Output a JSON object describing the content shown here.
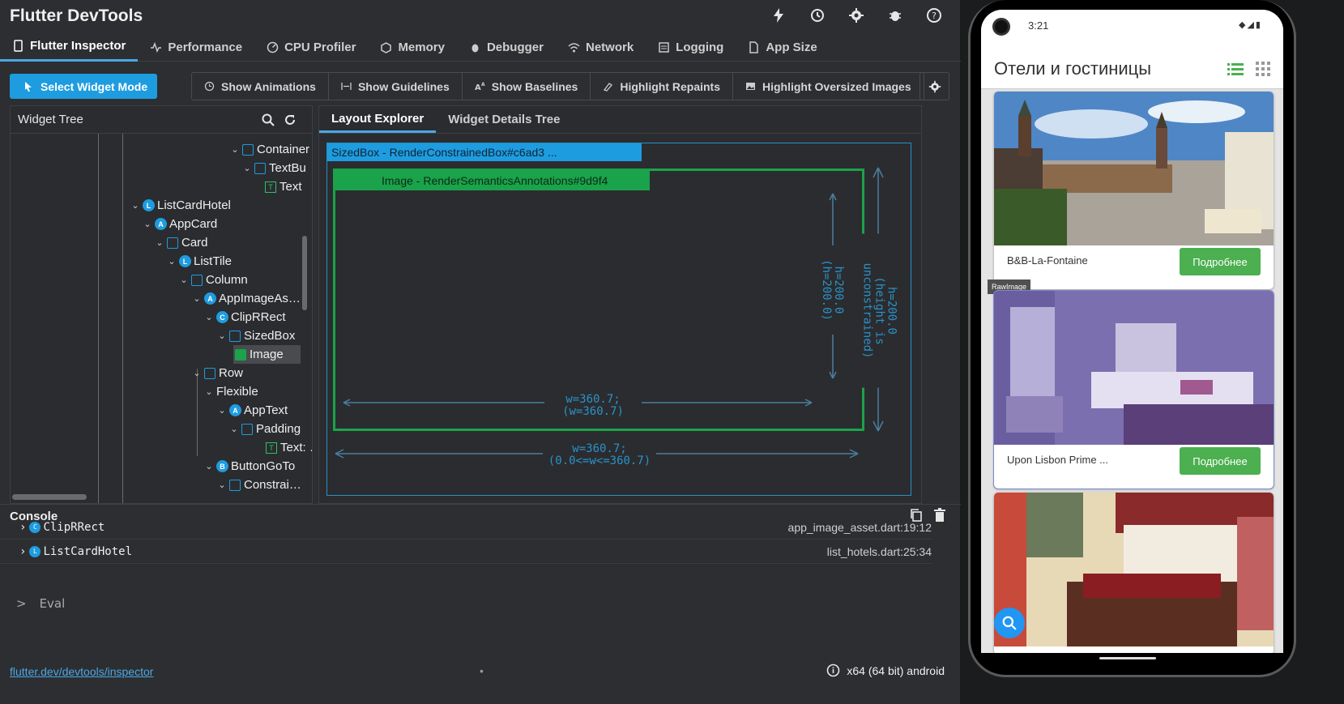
{
  "app": {
    "title": "Flutter DevTools"
  },
  "tabs": [
    {
      "label": "Flutter Inspector",
      "icon": "phone-icon",
      "active": true
    },
    {
      "label": "Performance",
      "icon": "pulse-icon"
    },
    {
      "label": "CPU Profiler",
      "icon": "gauge-icon"
    },
    {
      "label": "Memory",
      "icon": "memory-icon"
    },
    {
      "label": "Debugger",
      "icon": "bug-icon"
    },
    {
      "label": "Network",
      "icon": "wifi-icon"
    },
    {
      "label": "Logging",
      "icon": "logging-icon"
    },
    {
      "label": "App Size",
      "icon": "file-icon"
    }
  ],
  "toolbar": {
    "select_widget_mode": "Select Widget Mode",
    "toggles": [
      {
        "label": "Show Animations",
        "icon": "clock-icon"
      },
      {
        "label": "Show Guidelines",
        "icon": "guidelines-icon"
      },
      {
        "label": "Show Baselines",
        "icon": "baseline-icon"
      },
      {
        "label": "Highlight Repaints",
        "icon": "paint-icon"
      },
      {
        "label": "Highlight Oversized Images",
        "icon": "image-icon"
      }
    ]
  },
  "tree": {
    "title": "Widget Tree",
    "nodes": [
      {
        "label": "Container",
        "badge": "square",
        "selected": false
      },
      {
        "label": "TextBu",
        "badge": "button",
        "selected": false
      },
      {
        "label": "Text",
        "badge": "T",
        "selected": false
      },
      {
        "label": "ListCardHotel",
        "badge": "L",
        "selected": false
      },
      {
        "label": "AppCard",
        "badge": "A",
        "selected": false
      },
      {
        "label": "Card",
        "badge": "card",
        "selected": false
      },
      {
        "label": "ListTile",
        "badge": "L",
        "selected": false
      },
      {
        "label": "Column",
        "badge": "column",
        "selected": false
      },
      {
        "label": "AppImageAs…",
        "badge": "A",
        "selected": false
      },
      {
        "label": "ClipRRect",
        "badge": "C",
        "selected": false
      },
      {
        "label": "SizedBox",
        "badge": "box",
        "selected": false
      },
      {
        "label": "Image",
        "badge": "image",
        "selected": true
      },
      {
        "label": "Row",
        "badge": "row",
        "selected": false
      },
      {
        "label": "Flexible",
        "badge": "none",
        "selected": false
      },
      {
        "label": "AppText",
        "badge": "A",
        "selected": false
      },
      {
        "label": "Padding",
        "badge": "padding",
        "selected": false
      },
      {
        "label": "Text: …",
        "badge": "T",
        "selected": false
      },
      {
        "label": "ButtonGoTo",
        "badge": "B",
        "selected": false
      },
      {
        "label": "Constrai…",
        "badge": "box",
        "selected": false
      }
    ]
  },
  "details": {
    "tabs": [
      "Layout Explorer",
      "Widget Details Tree"
    ],
    "sizedbox_label": "SizedBox - RenderConstrainedBox#c6ad3 ...",
    "image_label": "Image - RenderSemanticsAnnotations#9d9f4",
    "inner_w": "w=360.7;",
    "inner_w2": "(w=360.7)",
    "inner_h": "h=200.0",
    "inner_h2": "(h=200.0)",
    "outer_w": "w=360.7;",
    "outer_w2": "(0.0<=w<=360.7)",
    "outer_h": "h=200.0",
    "outer_h2": "(height is unconstrained)"
  },
  "console": {
    "title": "Console",
    "rows": [
      {
        "badge": "C",
        "label": "ClipRRect",
        "source": "app_image_asset.dart:19:12"
      },
      {
        "badge": "L",
        "label": "ListCardHotel",
        "source": "list_hotels.dart:25:34"
      }
    ],
    "eval_prompt": ">",
    "eval_label": "Eval"
  },
  "statusbar": {
    "link": "flutter.dev/devtools/inspector",
    "dot": "•",
    "device": "x64 (64 bit) android"
  },
  "phone": {
    "time": "3:21",
    "appbar_title": "Отели и гостиницы",
    "tooltip": "RawImage",
    "cards": [
      {
        "name": "B&B-La-Fontaine",
        "button": "Подробнее"
      },
      {
        "name": "Upon Lisbon Prime ...",
        "button": "Подробнее"
      }
    ]
  },
  "colors": {
    "accent": "#1e9ce0",
    "green": "#1aa34a",
    "button_green": "#4caf50"
  }
}
